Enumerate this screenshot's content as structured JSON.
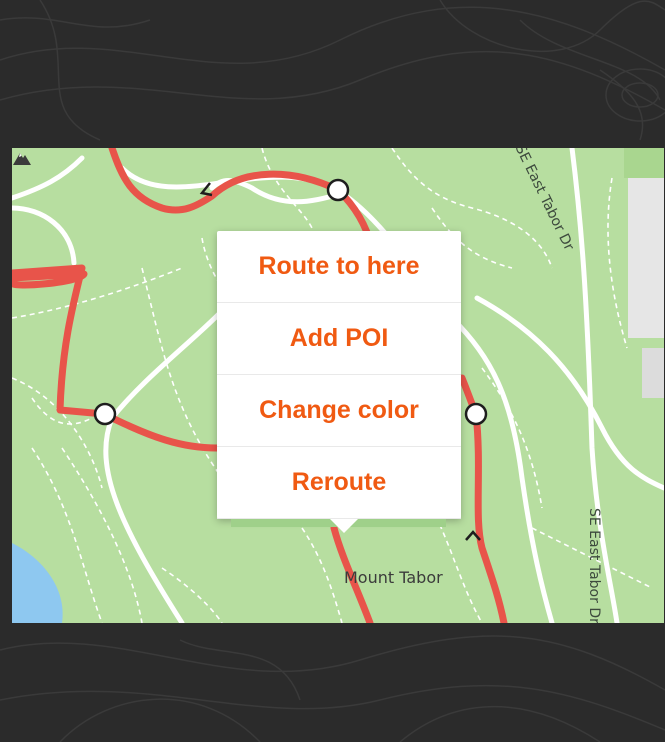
{
  "map": {
    "street_top": "SE East Tabor Dr",
    "street_side": "SE East Tabor Dr",
    "poi_name": "Mount Tabor",
    "poi_icon": "mountain-peak-icon"
  },
  "context_menu": {
    "items": [
      {
        "label": "Route to here"
      },
      {
        "label": "Add POI"
      },
      {
        "label": "Change color"
      },
      {
        "label": "Reroute"
      }
    ]
  },
  "colors": {
    "accent": "#f05a12",
    "route": "#e8544a",
    "park": "#b7dea0",
    "path": "#ffffff",
    "water": "#8ec8f0",
    "background": "#2b2b2b"
  }
}
